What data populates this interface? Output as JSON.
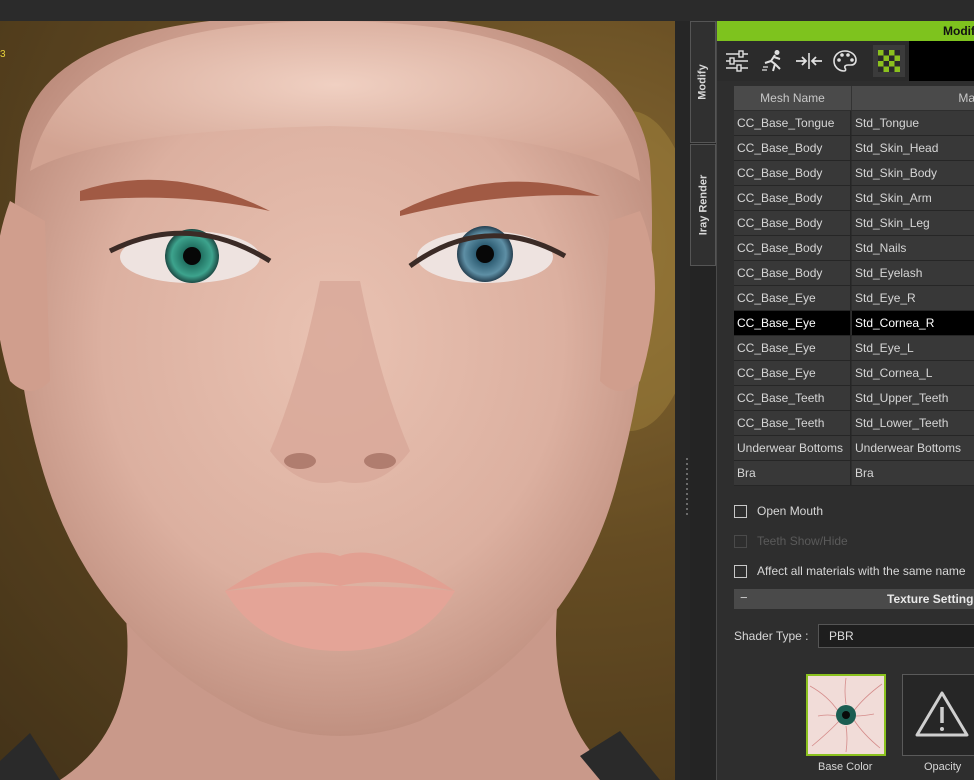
{
  "side_tabs": [
    "Modify",
    "Iray Render"
  ],
  "panel": {
    "header": "Modif"
  },
  "toolbar": {
    "tools": [
      "sliders-icon",
      "motion-figure-icon",
      "arrows-inward-icon",
      "palette-icon",
      "checker-texture-icon"
    ]
  },
  "table": {
    "headers": [
      "Mesh Name",
      "Ma"
    ],
    "rows": [
      [
        "CC_Base_Tongue",
        "Std_Tongue"
      ],
      [
        "CC_Base_Body",
        "Std_Skin_Head"
      ],
      [
        "CC_Base_Body",
        "Std_Skin_Body"
      ],
      [
        "CC_Base_Body",
        "Std_Skin_Arm"
      ],
      [
        "CC_Base_Body",
        "Std_Skin_Leg"
      ],
      [
        "CC_Base_Body",
        "Std_Nails"
      ],
      [
        "CC_Base_Body",
        "Std_Eyelash"
      ],
      [
        "CC_Base_Eye",
        "Std_Eye_R"
      ],
      [
        "CC_Base_Eye",
        "Std_Cornea_R"
      ],
      [
        "CC_Base_Eye",
        "Std_Eye_L"
      ],
      [
        "CC_Base_Eye",
        "Std_Cornea_L"
      ],
      [
        "CC_Base_Teeth",
        "Std_Upper_Teeth"
      ],
      [
        "CC_Base_Teeth",
        "Std_Lower_Teeth"
      ],
      [
        "Underwear Bottoms",
        "Underwear Bottoms"
      ],
      [
        "Bra",
        "Bra"
      ]
    ],
    "selected_index": 8
  },
  "options": {
    "open_mouth": "Open Mouth",
    "teeth_show_hide": "Teeth Show/Hide",
    "affect_all": "Affect all materials with the same name"
  },
  "texture_settings": {
    "title": "Texture Settings",
    "shader_label": "Shader Type :",
    "shader_value": "PBR",
    "slots": [
      "Base Color",
      "Opacity"
    ]
  },
  "colors": {
    "accent": "#7ec31e",
    "selected_row": "#000000"
  }
}
